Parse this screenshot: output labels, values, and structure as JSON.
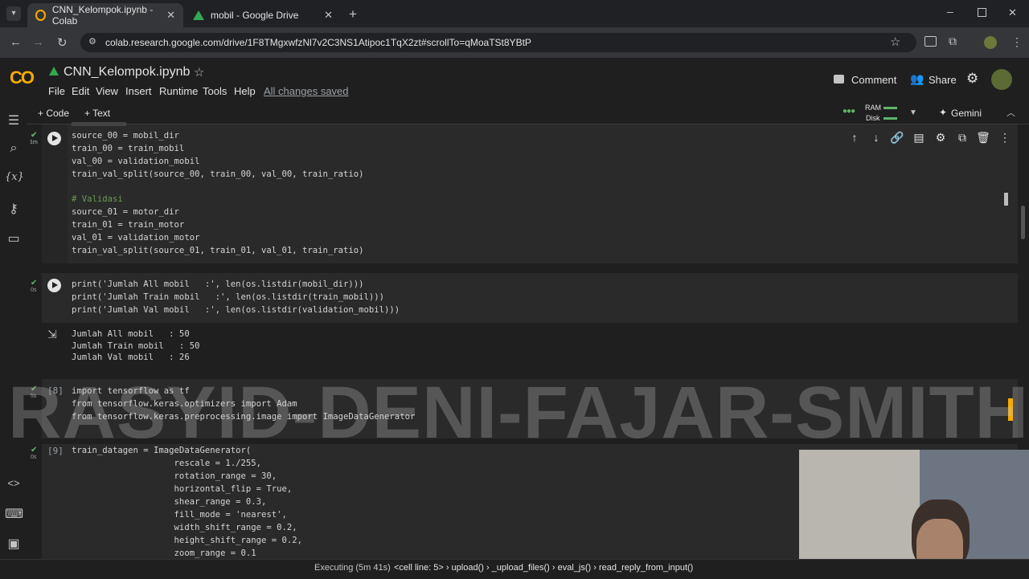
{
  "browser": {
    "tabs": [
      {
        "title": "CNN_Kelompok.ipynb - Colab",
        "active": true
      },
      {
        "title": "mobil - Google Drive",
        "active": false
      }
    ],
    "url": "colab.research.google.com/drive/1F8TMgxwfzNl7v2C3NS1Atipoc1TqX2zt#scrollTo=qMoaTSt8YBtP"
  },
  "header": {
    "logo": "CO",
    "notebook_title": "CNN_Kelompok.ipynb",
    "menu": [
      "File",
      "Edit",
      "View",
      "Insert",
      "Runtime",
      "Tools",
      "Help"
    ],
    "save_status": "All changes saved",
    "comment_label": "Comment",
    "share_label": "Share"
  },
  "toolbar": {
    "code_label": "+ Code",
    "text_label": "+ Text",
    "ram_label": "RAM",
    "disk_label": "Disk",
    "gemini_label": "Gemini"
  },
  "cells": [
    {
      "duration": "1m",
      "lines": [
        "source_00 = mobil_dir",
        "train_00 = train_mobil",
        "val_00 = validation_mobil",
        "train_val_split(source_00, train_00, val_00, train_ratio)",
        "",
        "# Validasi",
        "source_01 = motor_dir",
        "train_01 = train_motor",
        "val_01 = validation_motor",
        "train_val_split(source_01, train_01, val_01, train_ratio)"
      ]
    },
    {
      "duration": "0s",
      "lines": [
        "print('Jumlah All mobil   :', len(os.listdir(mobil_dir)))",
        "print('Jumlah Train mobil   :', len(os.listdir(train_mobil)))",
        "print('Jumlah Val mobil   :', len(os.listdir(validation_mobil)))"
      ],
      "output": [
        "Jumlah All mobil   : 50",
        "Jumlah Train mobil   : 50",
        "Jumlah Val mobil   : 26"
      ]
    },
    {
      "exec_count": "[8]",
      "duration": "5s",
      "lines": [
        "import tensorflow as tf",
        "from tensorflow.keras.optimizers import Adam",
        "from tensorflow.keras.preprocessing.image import ImageDataGenerator"
      ]
    },
    {
      "exec_count": "[9]",
      "duration": "0s",
      "lines": [
        "train_datagen = ImageDataGenerator(",
        "                    rescale = 1./255,",
        "                    rotation_range = 30,",
        "                    horizontal_flip = True,",
        "                    shear_range = 0.3,",
        "                    fill_mode = 'nearest',",
        "                    width_shift_range = 0.2,",
        "                    height_shift_range = 0.2,",
        "                    zoom_range = 0.1"
      ]
    }
  ],
  "watermark": "RASYID-DENI-FAJAR-SMITH",
  "status": {
    "executing": "Executing (5m 41s)",
    "stack": "<cell line: 5> › upload() › _upload_files() › eval_js() › read_reply_from_input()"
  },
  "colors": {
    "accent_orange": "#f9ab00",
    "check_green": "#5fb56b",
    "editor_bg": "#2a2a2a"
  }
}
